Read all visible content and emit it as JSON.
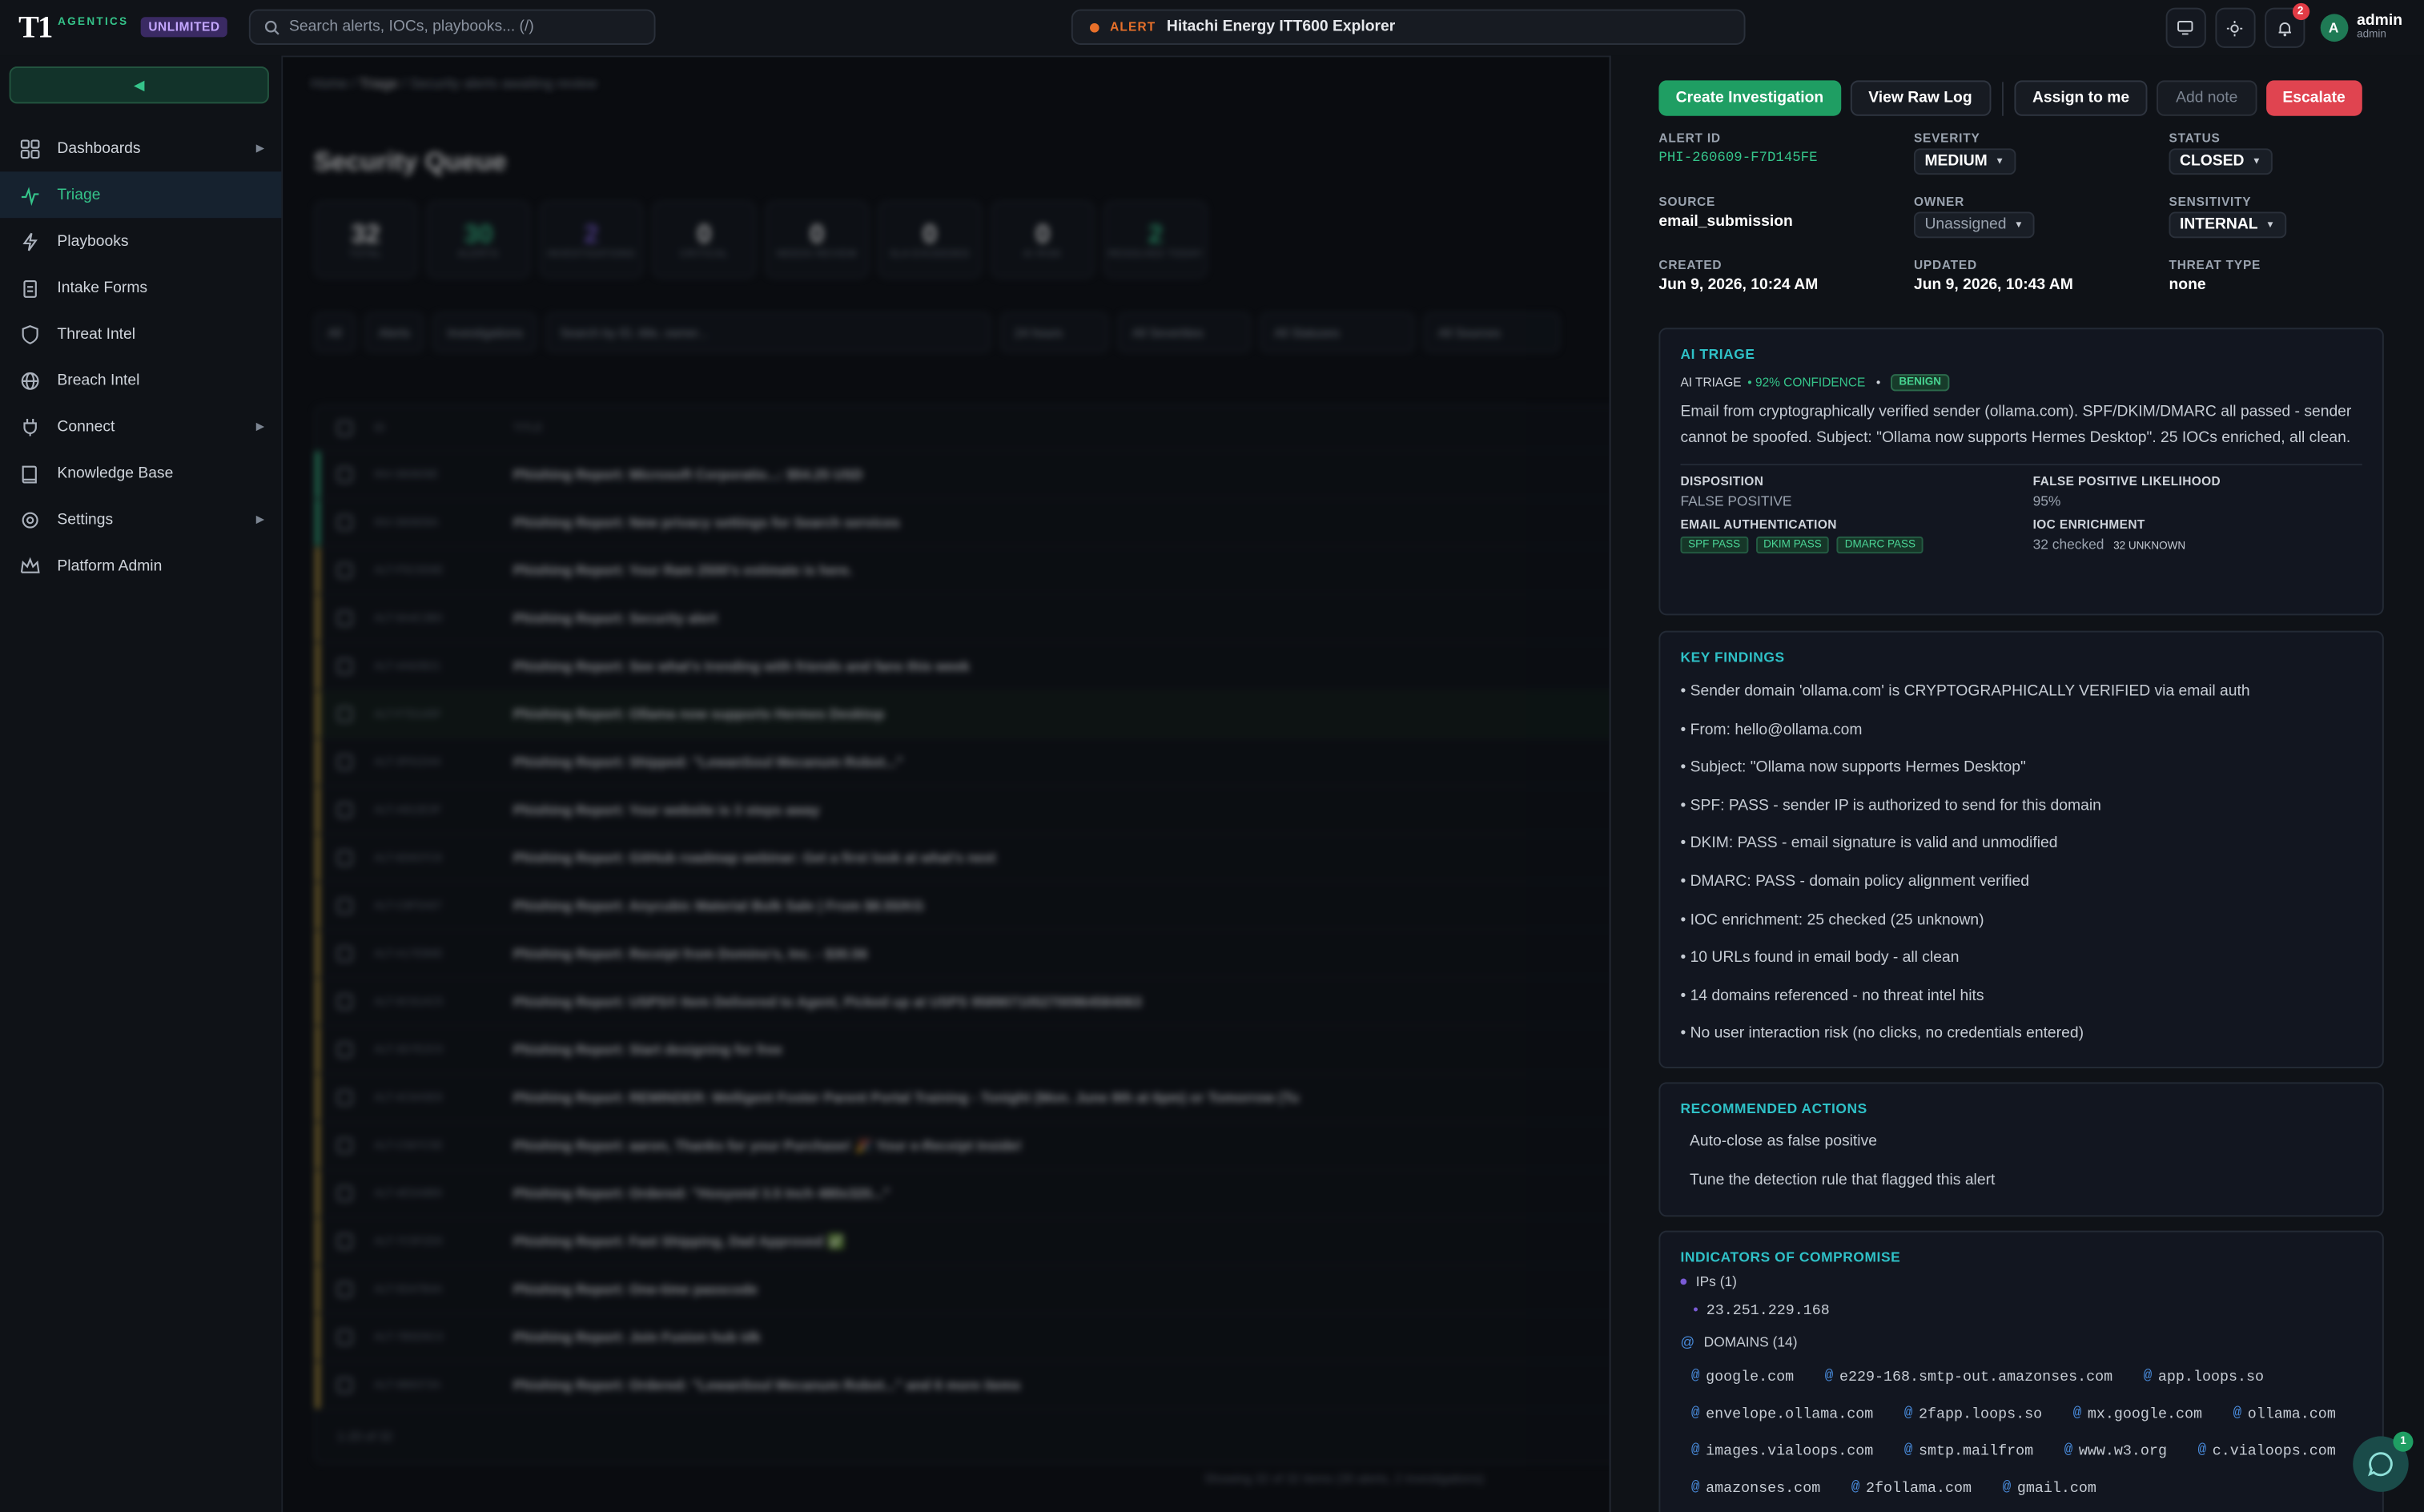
{
  "app": {
    "logo_mark": "T1",
    "logo_text": "AGENTICS",
    "plan": "UNLIMITED"
  },
  "search": {
    "placeholder": "Search alerts, IOCs, playbooks... (/)"
  },
  "active_alert": {
    "tag": "ALERT",
    "name": "Hitachi Energy ITT600 Explorer"
  },
  "notifications": {
    "count": "2"
  },
  "user": {
    "initial": "A",
    "name": "admin",
    "role": "admin"
  },
  "sidebar": {
    "items": [
      {
        "label": "Dashboards",
        "icon": "grid-icon",
        "has_children": true
      },
      {
        "label": "Triage",
        "icon": "pulse-icon",
        "active": true
      },
      {
        "label": "Playbooks",
        "icon": "bolt-icon"
      },
      {
        "label": "Intake Forms",
        "icon": "clipboard-icon"
      },
      {
        "label": "Threat Intel",
        "icon": "shield-icon"
      },
      {
        "label": "Breach Intel",
        "icon": "globe-icon"
      },
      {
        "label": "Connect",
        "icon": "plug-icon",
        "has_children": true
      },
      {
        "label": "Knowledge Base",
        "icon": "book-icon"
      },
      {
        "label": "Settings",
        "icon": "gear-icon",
        "has_children": true
      },
      {
        "label": "Platform Admin",
        "icon": "crown-icon"
      }
    ]
  },
  "main": {
    "breadcrumb": [
      "Home",
      "Triage",
      "Security alerts awaiting review"
    ],
    "title": "Security Queue",
    "stats": [
      {
        "value": "32",
        "label": "TOTAL",
        "color": "#ffffff"
      },
      {
        "value": "30",
        "label": "ALERTS",
        "color": "#35c48a"
      },
      {
        "value": "2",
        "label": "INVESTIGATIONS",
        "color": "#7a5bd6"
      },
      {
        "value": "0",
        "label": "CRITICAL",
        "color": "#ffffff"
      },
      {
        "value": "0",
        "label": "NEEDS REVIEW",
        "color": "#ffffff"
      },
      {
        "value": "0",
        "label": "SLA EXCEEDED",
        "color": "#ffffff"
      },
      {
        "value": "0",
        "label": "AI RISK",
        "color": "#ffffff"
      },
      {
        "value": "2",
        "label": "RESOLVED TODAY",
        "color": "#35c48a"
      }
    ],
    "filters": {
      "tabs": [
        "All",
        "Alerts",
        "Investigations"
      ],
      "search_placeholder": "Search by ID, title, owner...",
      "time": "24 hours",
      "severity": "All Severities",
      "status": "All Statuses",
      "source": "All Sources"
    },
    "columns": [
      "ID",
      "TITLE"
    ],
    "rows": [
      {
        "id": "INV-360609E",
        "title": "Phishing Report: Microsoft Corporatio...: $54.25 USD",
        "edge": "#35c48a"
      },
      {
        "id": "INV-360609A",
        "title": "Phishing Report: New privacy settings for Search services",
        "edge": "#35c48a"
      },
      {
        "id": "ALT-F5C0D6E",
        "title": "Phishing Report: Your Ram 2500's estimate is here.",
        "edge": "#c8a23a"
      },
      {
        "id": "ALT-9A4C3B0",
        "title": "Phishing Report: Security alert",
        "edge": "#c8a23a"
      },
      {
        "id": "ALT-4A62B21",
        "title": "Phishing Report: See what's trending with friends and fans this week",
        "edge": "#c8a23a"
      },
      {
        "id": "ALT-F7D145F",
        "title": "Phishing Report: Ollama now supports Hermes Desktop",
        "edge": "#c8a23a"
      },
      {
        "id": "ALT-3F61D44",
        "title": "Phishing Report: Shipped: \"LewanSoul Mecanum Robot...\"",
        "edge": "#c8a23a"
      },
      {
        "id": "ALT-A812E3F",
        "title": "Phishing Report: Your website is 3 steps away",
        "edge": "#c8a23a"
      },
      {
        "id": "ALT-6D637C8",
        "title": "Phishing Report: GitHub roadmap webinar: Get a first look at what's next",
        "edge": "#c8a23a"
      },
      {
        "id": "ALT-C8F5A67",
        "title": "Phishing Report: Anycubic Material Bulk Sale | From $8.55/KG",
        "edge": "#c8a23a"
      },
      {
        "id": "ALT-A17EB6E",
        "title": "Phishing Report: Receipt from Domino's, Inc. - $30.56",
        "edge": "#c8a23a"
      },
      {
        "id": "ALT-9C91AC5",
        "title": "Phishing Report: USPS® Item Delivered to Agent, Picked up at USPS 9589071052700964584063",
        "edge": "#c8a23a"
      },
      {
        "id": "ALT-3D7E2C0",
        "title": "Phishing Report: Start designing for free",
        "edge": "#c8a23a"
      },
      {
        "id": "ALT-4C6A5E8",
        "title": "Phishing Report: REMINDER: Welligent Foster Parent Portal Training - Tonight (Mon. June 8th at 6pm) or Tomorrow (Tu",
        "edge": "#c8a23a"
      },
      {
        "id": "ALT-C587C5E",
        "title": "Phishing Report: aaron, Thanks for your Purchase! 🎉 Your e-Receipt Inside!",
        "edge": "#c8a23a"
      },
      {
        "id": "ALT-4E5A8B9",
        "title": "Phishing Report: Ordered: \"Hosyond 3.5 Inch 480x320...\"",
        "edge": "#c8a23a"
      },
      {
        "id": "ALT-7C5F2D0",
        "title": "Phishing Report: Fast Shipping, Dad Approved ✅",
        "edge": "#c8a23a"
      },
      {
        "id": "ALT-5D47B4A",
        "title": "Phishing Report: One-time passcode",
        "edge": "#c8a23a"
      },
      {
        "id": "ALT-7B5D5C3",
        "title": "Phishing Report: Join Fusion hub idk",
        "edge": "#c8a23a"
      },
      {
        "id": "ALT-9B8373A",
        "title": "Phishing Report: Ordered: \"LewanSoul Mecanum Robot...\" and 6 more items",
        "edge": "#c8a23a"
      }
    ],
    "pagination": "1-20 of 32",
    "footer": "Showing 32 of 32 items (30 alerts, 2 investigations)"
  },
  "panel": {
    "actions": {
      "create": "Create Investigation",
      "raw_log": "View Raw Log",
      "assign": "Assign to me",
      "note": "Add note",
      "escalate": "Escalate"
    },
    "meta": {
      "alert_id_label": "ALERT ID",
      "alert_id": "PHI-260609-F7D145FE",
      "severity_label": "SEVERITY",
      "severity": "MEDIUM",
      "status_label": "STATUS",
      "status": "CLOSED",
      "source_label": "SOURCE",
      "source": "email_submission",
      "owner_label": "OWNER",
      "owner": "Unassigned",
      "sensitivity_label": "SENSITIVITY",
      "sensitivity": "INTERNAL",
      "created_label": "CREATED",
      "created": "Jun 9, 2026, 10:24 AM",
      "updated_label": "UPDATED",
      "updated": "Jun 9, 2026, 10:43 AM",
      "threat_label": "THREAT TYPE",
      "threat": "none"
    },
    "ai_triage": {
      "title": "AI TRIAGE",
      "label": "AI TRIAGE",
      "confidence": "• 92% CONFIDENCE",
      "sep": "•",
      "verdict": "BENIGN",
      "summary": "Email from cryptographically verified sender (ollama.com). SPF/DKIM/DMARC all passed - sender cannot be spoofed. Subject: \"Ollama now supports Hermes Desktop\". 25 IOCs enriched, all clean.",
      "disposition_label": "DISPOSITION",
      "disposition": "FALSE POSITIVE",
      "fp_label": "FALSE POSITIVE LIKELIHOOD",
      "fp": "95%",
      "auth_label": "EMAIL AUTHENTICATION",
      "auth": [
        "SPF PASS",
        "DKIM PASS",
        "DMARC PASS"
      ],
      "enrich_label": "IOC ENRICHMENT",
      "enrich_checked": "32 checked",
      "enrich_unknown": "32 UNKNOWN"
    },
    "findings": {
      "title": "KEY FINDINGS",
      "items": [
        "• Sender domain 'ollama.com' is CRYPTOGRAPHICALLY VERIFIED via email auth",
        "• From: hello@ollama.com",
        "• Subject: \"Ollama now supports Hermes Desktop\"",
        "• SPF: PASS - sender IP is authorized to send for this domain",
        "• DKIM: PASS - email signature is valid and unmodified",
        "• DMARC: PASS - domain policy alignment verified",
        "• IOC enrichment: 25 checked (25 unknown)",
        "• 10 URLs found in email body - all clean",
        "• 14 domains referenced - no threat intel hits",
        "• No user interaction risk (no clicks, no credentials entered)"
      ]
    },
    "recommended": {
      "title": "RECOMMENDED ACTIONS",
      "items": [
        "Auto-close as false positive",
        "Tune the detection rule that flagged this alert"
      ]
    },
    "iocs": {
      "title": "INDICATORS OF COMPROMISE",
      "ips_label": "IPs (1)",
      "ips": [
        "23.251.229.168"
      ],
      "domains_label": "DOMAINS (14)",
      "domains": [
        "google.com",
        "e229-168.smtp-out.amazonses.com",
        "app.loops.so",
        "envelope.ollama.com",
        "2fapp.loops.so",
        "mx.google.com",
        "ollama.com",
        "images.vialoops.com",
        "smtp.mailfrom",
        "www.w3.org",
        "c.vialoops.com",
        "amazonses.com",
        "2follama.com",
        "gmail.com"
      ]
    }
  },
  "chat": {
    "badge": "1"
  }
}
